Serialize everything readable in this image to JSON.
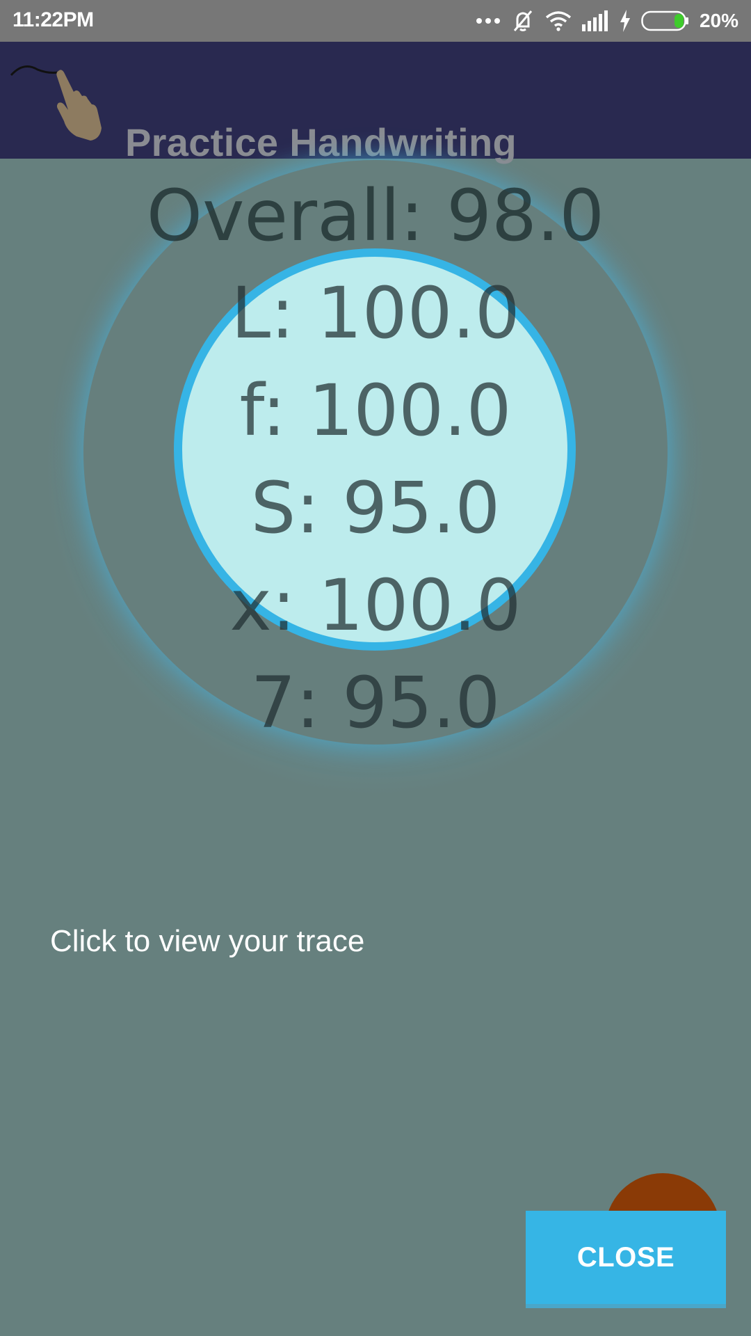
{
  "status_bar": {
    "time": "11:22PM",
    "battery_percent": "20%",
    "battery_level": 0.2,
    "icons": [
      "more-dots-icon",
      "mute-icon",
      "wifi-icon",
      "signal-icon",
      "charging-icon",
      "battery-icon"
    ]
  },
  "app_bar": {
    "title": "Practice Handwriting",
    "logo_icon": "hand-pen-icon"
  },
  "scores": {
    "overall": "Overall: 98.0",
    "letters": [
      {
        "text": "L: 100.0"
      },
      {
        "text": "f: 100.0"
      },
      {
        "text": "S: 95.0"
      },
      {
        "text": "x: 100.0"
      },
      {
        "text": "7: 95.0"
      }
    ]
  },
  "trace_link": "Click to view your trace",
  "close_button": "CLOSE",
  "colors": {
    "overlay": "#66807e",
    "app_bar": "#292950",
    "accent": "#36b5e5",
    "fab": "#8a3a06"
  }
}
